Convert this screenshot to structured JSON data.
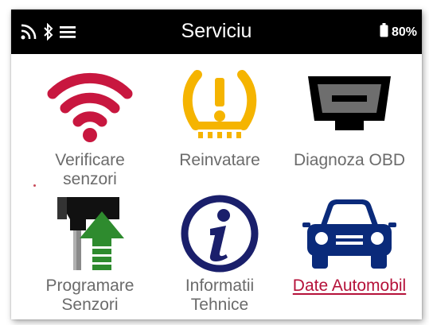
{
  "status_bar": {
    "title": "Serviciu",
    "battery_text": "80%",
    "icons": [
      "wifi-icon",
      "bluetooth-icon",
      "menu-icon",
      "battery-icon"
    ]
  },
  "tiles": [
    {
      "id": "verificare",
      "label_line1": "Verificare",
      "label_line2": "senzori",
      "icon": "wifi-signal-icon",
      "color": "#c8173f"
    },
    {
      "id": "reinvatare",
      "label_line1": "Reinvatare",
      "label_line2": "",
      "icon": "tpms-warning-icon",
      "color": "#f5b400"
    },
    {
      "id": "obd",
      "label_line1": "Diagnoza OBD",
      "label_line2": "",
      "icon": "obd-connector-icon",
      "color": "#000000"
    },
    {
      "id": "programare",
      "label_line1": "Programare",
      "label_line2": "Senzori",
      "icon": "sensor-program-icon",
      "color": "#2e8b2e"
    },
    {
      "id": "informatii",
      "label_line1": "Informatii",
      "label_line2": "Tehnice",
      "icon": "info-icon",
      "color": "#1a1f6b"
    },
    {
      "id": "date-auto",
      "label_line1": "Date Automobil",
      "label_line2": "",
      "icon": "car-icon",
      "color": "#0a2a7a"
    }
  ],
  "colors": {
    "status_bar_bg": "#000000",
    "label_text": "#6b6b6b",
    "highlight_label": "#b5123a"
  }
}
